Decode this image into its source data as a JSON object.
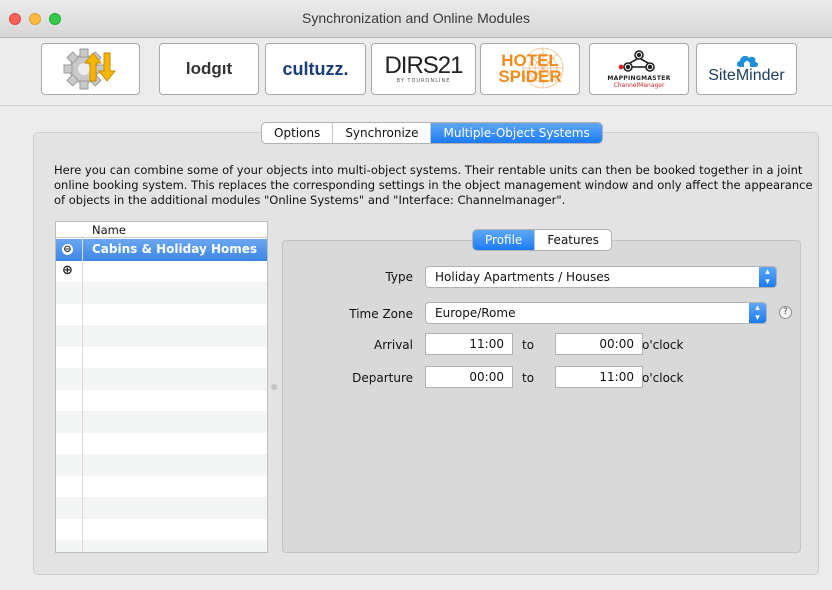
{
  "window": {
    "title": "Synchronization and Online Modules"
  },
  "toolbar": {
    "modules": [
      {
        "name": "sync",
        "icon": "gear-sync-arrows-icon"
      },
      {
        "name": "lodgit",
        "label": "lodgıt"
      },
      {
        "name": "cultuzz",
        "label": "cultuzz."
      },
      {
        "name": "dirs21",
        "label": "DIRS21",
        "sub": "BY TOURONLINE"
      },
      {
        "name": "hotelspider",
        "label_line1": "HOTEL",
        "label_line2": "SPIDER"
      },
      {
        "name": "mappingmaster",
        "label_line1": "MAPPINGMASTER",
        "label_line2": "ChannelManager"
      },
      {
        "name": "siteminder",
        "label": "SiteMinder"
      }
    ]
  },
  "tabs": {
    "items": [
      "Options",
      "Synchronize",
      "Multiple-Object Systems"
    ],
    "active": "Multiple-Object Systems"
  },
  "description": "Here you can combine some of your objects into multi-object systems. Their rentable units can then be booked together in a joint online booking system. This replaces the corresponding settings in the object management window and only affect the appearance of objects in the additional modules \"Online Systems\" and \"Interface: Channelmanager\".",
  "list": {
    "header": "Name",
    "rows": [
      {
        "label": "Cabins & Holiday Homes",
        "button": "⊖",
        "selected": true
      },
      {
        "label": "",
        "button": "⊕",
        "selected": false
      }
    ]
  },
  "subtabs": {
    "items": [
      "Profile",
      "Features"
    ],
    "active": "Profile"
  },
  "form": {
    "type_label": "Type",
    "type_value": "Holiday Apartments / Houses",
    "timezone_label": "Time Zone",
    "timezone_value": "Europe/Rome",
    "help": "?",
    "arrival_label": "Arrival",
    "arrival_from": "11:00",
    "arrival_to": "00:00",
    "departure_label": "Departure",
    "departure_from": "00:00",
    "departure_to": "11:00",
    "to_label": "to",
    "oclock_label": "o'clock"
  },
  "colors": {
    "accent": "#1b7bf4",
    "selection": "#3d86e5"
  }
}
